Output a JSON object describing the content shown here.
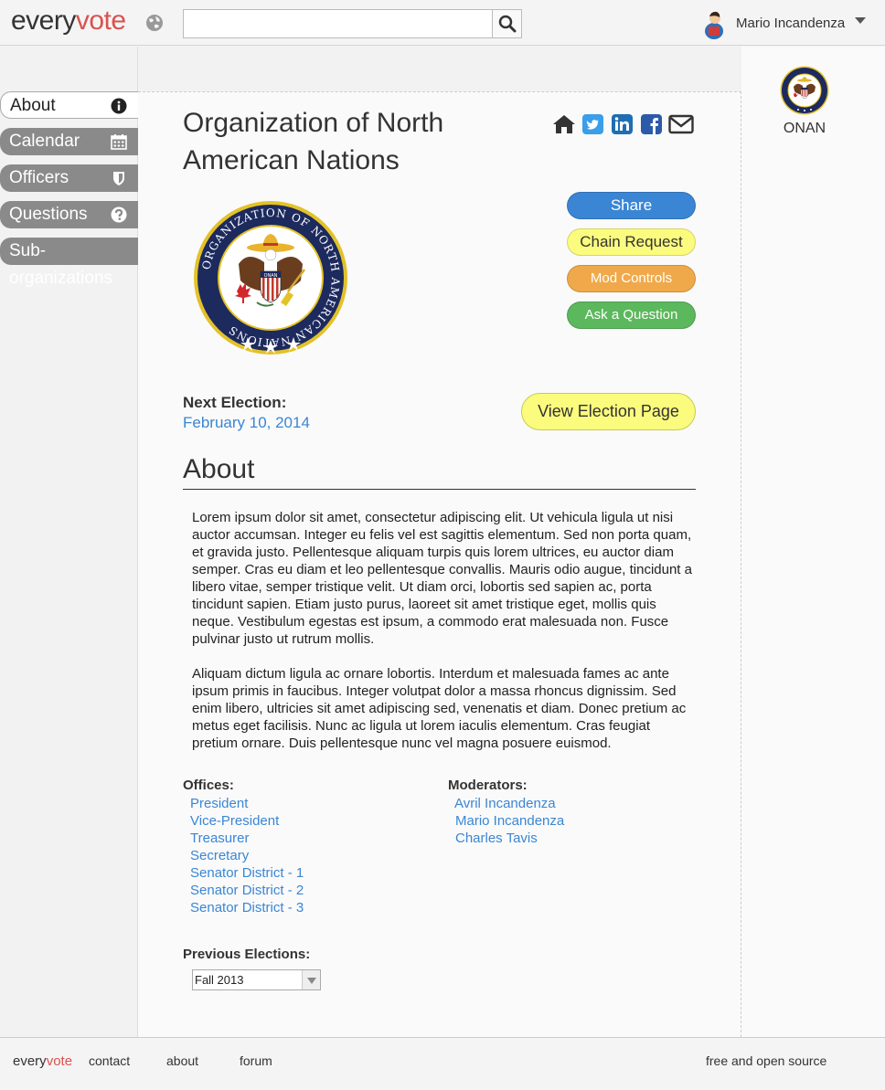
{
  "header": {
    "logo_every": "every",
    "logo_vote": "vote",
    "search_placeholder": "",
    "user_name": "Mario Incandenza"
  },
  "sidebar": {
    "items": [
      {
        "label": "About",
        "icon": "info-icon",
        "active": true
      },
      {
        "label": "Calendar",
        "icon": "calendar-icon",
        "active": false
      },
      {
        "label": "Officers",
        "icon": "shield-icon",
        "active": false
      },
      {
        "label": "Questions",
        "icon": "question-icon",
        "active": false
      },
      {
        "label": "Sub-organizations",
        "icon": "",
        "active": false
      }
    ]
  },
  "org": {
    "title": "Organization of North American Nations",
    "seal_text": "ORGANIZATION OF NORTH AMERICAN NATIONS",
    "seal_abbrev": "ONAN",
    "share_icons": [
      "home-icon",
      "twitter-icon",
      "linkedin-icon",
      "facebook-icon",
      "email-icon"
    ]
  },
  "actions": {
    "share": "Share",
    "chain": "Chain Request",
    "mod": "Mod Controls",
    "ask": "Ask a Question"
  },
  "election": {
    "label": "Next Election:",
    "date": "February 10, 2014",
    "button": "View Election Page"
  },
  "about": {
    "heading": "About",
    "para1": "Lorem ipsum dolor sit amet, consectetur adipiscing elit. Ut vehicula ligula ut nisi auctor accumsan. Integer eu felis vel est sagittis elementum. Sed non porta quam, et gravida justo. Pellentesque aliquam turpis quis lorem ultrices, eu auctor diam semper. Cras eu diam et leo pellentesque convallis. Mauris odio augue, tincidunt a libero vitae, semper tristique velit. Ut diam orci, lobortis sed sapien ac, porta tincidunt sapien. Etiam justo purus, laoreet sit amet tristique eget, mollis quis neque. Vestibulum egestas est ipsum, a commodo erat malesuada non. Fusce pulvinar justo ut rutrum mollis.",
    "para2": "Aliquam dictum ligula ac ornare lobortis. Interdum et malesuada fames ac ante ipsum primis in faucibus. Integer volutpat dolor a massa rhoncus dignissim. Sed enim libero, ultricies sit amet adipiscing sed, venenatis et diam. Donec pretium ac metus eget facilisis. Nunc ac ligula ut lorem iaculis elementum. Cras feugiat pretium ornare. Duis pellentesque nunc vel magna posuere euismod."
  },
  "offices": {
    "label": "Offices:",
    "items": [
      "President",
      "Vice-President",
      "Treasurer",
      "Secretary",
      "Senator District - 1",
      "Senator District - 2",
      "Senator District - 3"
    ]
  },
  "moderators": {
    "label": "Moderators:",
    "items": [
      "Avril Incandenza",
      "Mario Incandenza",
      "Charles Tavis"
    ]
  },
  "previous": {
    "label": "Previous Elections:",
    "selected": "Fall 2013"
  },
  "right_panel": {
    "label": "ONAN"
  },
  "footer": {
    "logo_every": "every",
    "logo_vote": "vote",
    "contact": "contact",
    "about": "about",
    "forum": "forum",
    "oss": "free and open source"
  },
  "colors": {
    "accent_red": "#d9534f",
    "link_blue": "#3a86d4",
    "share_blue": "#3a86d4",
    "chain_yellow": "#fbfb7d",
    "mod_orange": "#f0a94a",
    "ask_green": "#5cb85c",
    "nav_gray": "#8a8a8a",
    "seal_navy": "#1d2a5e",
    "seal_gold": "#e3c229"
  }
}
